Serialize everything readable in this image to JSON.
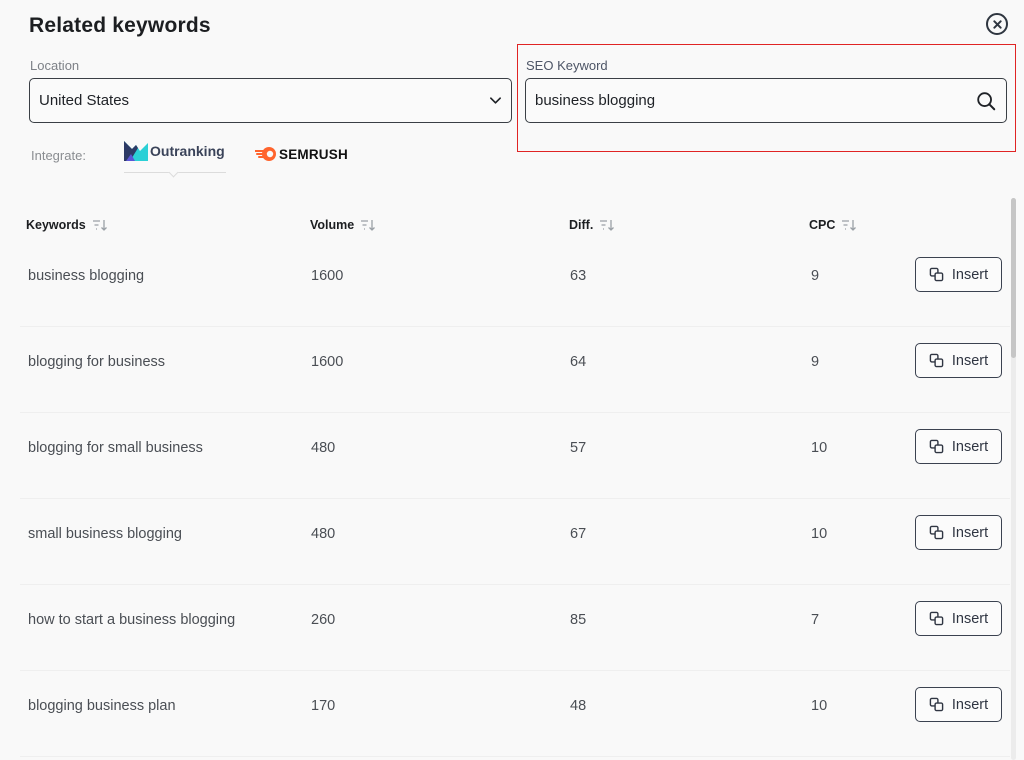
{
  "modal": {
    "title": "Related keywords",
    "close_icon": "close-circle-icon"
  },
  "location": {
    "label": "Location",
    "value": "United States",
    "icon": "chevron-down-icon"
  },
  "seo_keyword": {
    "label": "SEO Keyword",
    "value": "business blogging",
    "icon": "search-icon"
  },
  "integrate": {
    "label": "Integrate:",
    "brands": [
      {
        "name": "Outranking",
        "selected": true,
        "color": "#3a4359"
      },
      {
        "name": "SEMRUSH",
        "selected": false,
        "color": "#ff642d"
      }
    ]
  },
  "table": {
    "columns": [
      {
        "label": "Keywords",
        "icon": "sort-icon"
      },
      {
        "label": "Volume",
        "icon": "sort-icon"
      },
      {
        "label": "Diff.",
        "icon": "sort-icon"
      },
      {
        "label": "CPC",
        "icon": "sort-icon"
      }
    ],
    "action_label": "Insert",
    "action_icon": "copy-icon",
    "rows": [
      {
        "keyword": "business blogging",
        "volume": "1600",
        "diff": "63",
        "cpc": "9"
      },
      {
        "keyword": "blogging for business",
        "volume": "1600",
        "diff": "64",
        "cpc": "9"
      },
      {
        "keyword": "blogging for small business",
        "volume": "480",
        "diff": "57",
        "cpc": "10"
      },
      {
        "keyword": "small business blogging",
        "volume": "480",
        "diff": "67",
        "cpc": "10"
      },
      {
        "keyword": "how to start a business blogging",
        "volume": "260",
        "diff": "85",
        "cpc": "7"
      },
      {
        "keyword": "blogging business plan",
        "volume": "170",
        "diff": "48",
        "cpc": "10"
      }
    ]
  },
  "colors": {
    "highlight_border": "#e02424",
    "background": "#f9f9f9",
    "text_primary": "#1c1e21"
  }
}
